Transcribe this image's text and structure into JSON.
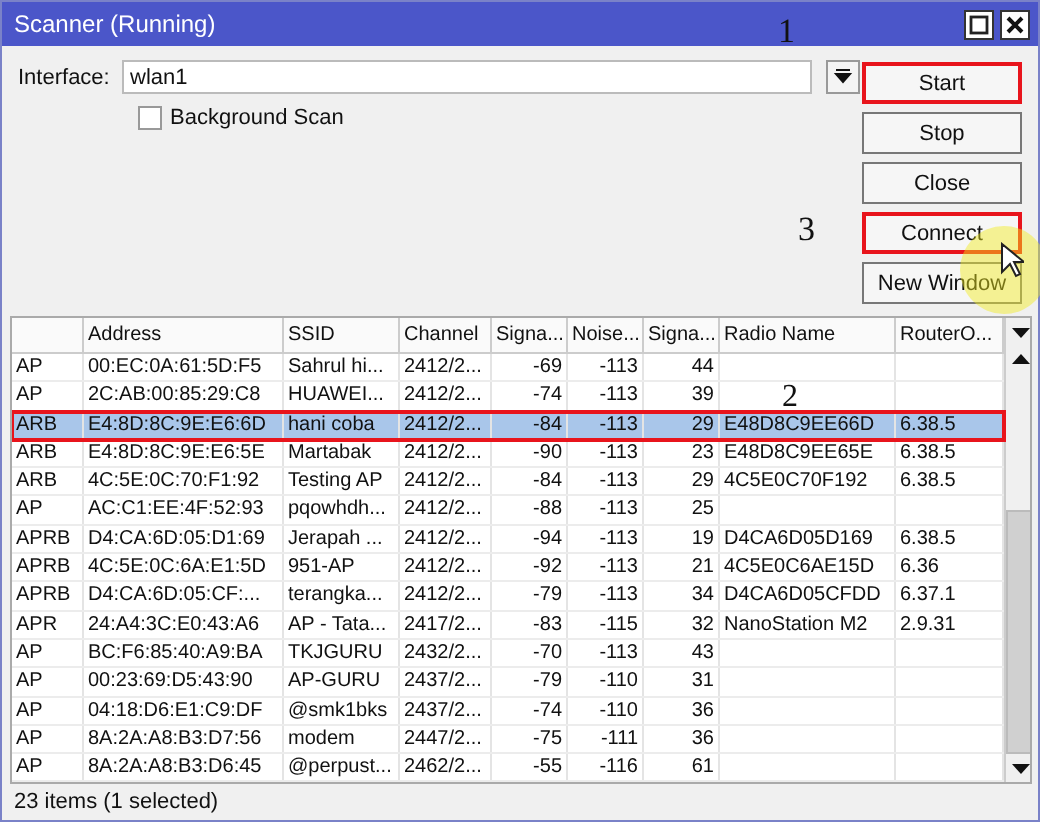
{
  "window": {
    "title": "Scanner (Running)"
  },
  "interface": {
    "label": "Interface:",
    "value": "wlan1"
  },
  "background_scan": {
    "label": "Background Scan",
    "checked": false
  },
  "buttons": [
    {
      "label": "Start",
      "marked": true,
      "annotation": "1"
    },
    {
      "label": "Stop",
      "marked": false
    },
    {
      "label": "Close",
      "marked": false
    },
    {
      "label": "Connect",
      "marked": true,
      "annotation": "3",
      "cursor": true
    },
    {
      "label": "New Window",
      "marked": false
    }
  ],
  "table": {
    "columns": [
      {},
      {
        "label": "Address"
      },
      {
        "label": "SSID"
      },
      {
        "label": "Channel"
      },
      {
        "label": "Signa..."
      },
      {
        "label": "Noise..."
      },
      {
        "label": "Signa..."
      },
      {
        "label": "Radio Name"
      },
      {
        "label": "RouterO..."
      }
    ],
    "rows": [
      {
        "cells": [
          "AP",
          "00:EC:0A:61:5D:F5",
          "Sahrul hi...",
          "2412/2...",
          "-69",
          "-113",
          "44",
          "",
          ""
        ],
        "selected": false,
        "marked": false
      },
      {
        "cells": [
          "AP",
          "2C:AB:00:85:29:C8",
          "HUAWEI...",
          "2412/2...",
          "-74",
          "-113",
          "39",
          "",
          ""
        ],
        "selected": false,
        "marked": false,
        "annotation": "2"
      },
      {
        "cells": [
          "ARB",
          "E4:8D:8C:9E:E6:6D",
          "hani coba",
          "2412/2...",
          "-84",
          "-113",
          "29",
          "E48D8C9EE66D",
          "6.38.5"
        ],
        "selected": true,
        "marked": true
      },
      {
        "cells": [
          "ARB",
          "E4:8D:8C:9E:E6:5E",
          "Martabak",
          "2412/2...",
          "-90",
          "-113",
          "23",
          "E48D8C9EE65E",
          "6.38.5"
        ],
        "selected": false,
        "marked": false
      },
      {
        "cells": [
          "ARB",
          "4C:5E:0C:70:F1:92",
          "Testing AP",
          "2412/2...",
          "-84",
          "-113",
          "29",
          "4C5E0C70F192",
          "6.38.5"
        ],
        "selected": false,
        "marked": false
      },
      {
        "cells": [
          "AP",
          "AC:C1:EE:4F:52:93",
          "pqowhdh...",
          "2412/2...",
          "-88",
          "-113",
          "25",
          "",
          ""
        ],
        "selected": false,
        "marked": false
      },
      {
        "cells": [
          "APRB",
          "D4:CA:6D:05:D1:69",
          "Jerapah ...",
          "2412/2...",
          "-94",
          "-113",
          "19",
          "D4CA6D05D169",
          "6.38.5"
        ],
        "selected": false,
        "marked": false
      },
      {
        "cells": [
          "APRB",
          "4C:5E:0C:6A:E1:5D",
          "951-AP",
          "2412/2...",
          "-92",
          "-113",
          "21",
          "4C5E0C6AE15D",
          "6.36"
        ],
        "selected": false,
        "marked": false
      },
      {
        "cells": [
          "APRB",
          "D4:CA:6D:05:CF:...",
          "terangka...",
          "2412/2...",
          "-79",
          "-113",
          "34",
          "D4CA6D05CFDD",
          "6.37.1"
        ],
        "selected": false,
        "marked": false
      },
      {
        "cells": [
          "APR",
          "24:A4:3C:E0:43:A6",
          "AP - Tata...",
          "2417/2...",
          "-83",
          "-115",
          "32",
          "NanoStation M2",
          "2.9.31"
        ],
        "selected": false,
        "marked": false
      },
      {
        "cells": [
          "AP",
          "BC:F6:85:40:A9:BA",
          "TKJGURU",
          "2432/2...",
          "-70",
          "-113",
          "43",
          "",
          ""
        ],
        "selected": false,
        "marked": false
      },
      {
        "cells": [
          "AP",
          "00:23:69:D5:43:90",
          "AP-GURU",
          "2437/2...",
          "-79",
          "-110",
          "31",
          "",
          ""
        ],
        "selected": false,
        "marked": false
      },
      {
        "cells": [
          "AP",
          "04:18:D6:E1:C9:DF",
          "@smk1bks",
          "2437/2...",
          "-74",
          "-110",
          "36",
          "",
          ""
        ],
        "selected": false,
        "marked": false
      },
      {
        "cells": [
          "AP",
          "8A:2A:A8:B3:D7:56",
          "modem",
          "2447/2...",
          "-75",
          "-111",
          "36",
          "",
          ""
        ],
        "selected": false,
        "marked": false
      },
      {
        "cells": [
          "AP",
          "8A:2A:A8:B3:D6:45",
          "@perpust...",
          "2462/2...",
          "-55",
          "-116",
          "61",
          "",
          ""
        ],
        "selected": false,
        "marked": false
      }
    ]
  },
  "status_bar": "23 items (1 selected)"
}
